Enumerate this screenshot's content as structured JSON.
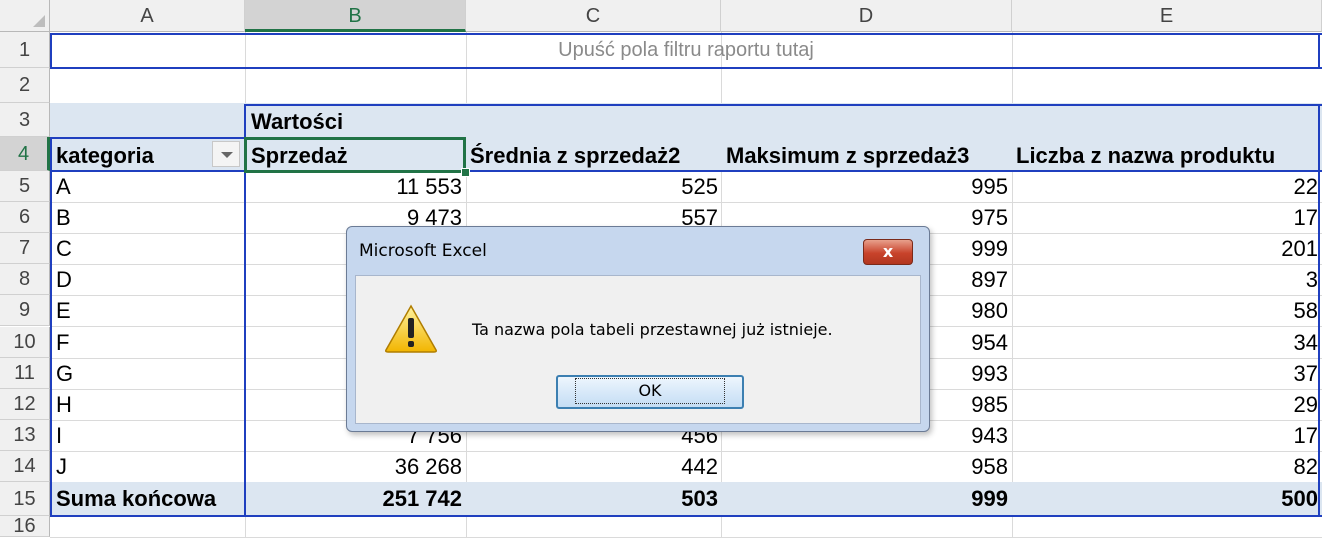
{
  "app": {
    "name": "Microsoft Excel"
  },
  "columns": [
    "A",
    "B",
    "C",
    "D",
    "E"
  ],
  "selected_column": "B",
  "rows": [
    "1",
    "2",
    "3",
    "4",
    "5",
    "6",
    "7",
    "8",
    "9",
    "10",
    "11",
    "12",
    "13",
    "14",
    "15",
    "16"
  ],
  "selected_row": "4",
  "pivot": {
    "filter_drop_label": "Upuść pola filtru raportu tutaj",
    "values_label": "Wartości",
    "row_field_header": "kategoria",
    "value_headers": [
      "Sprzedaż",
      "Średnia z sprzedaż2",
      "Maksimum z sprzedaż3",
      "Liczba z nazwa produktu"
    ],
    "data_rows": [
      {
        "cat": "A",
        "b": "11 553",
        "c": "525",
        "d": "995",
        "e": "22"
      },
      {
        "cat": "B",
        "b": "9 473",
        "c": "557",
        "d": "975",
        "e": "17"
      },
      {
        "cat": "C",
        "b": "",
        "c": "",
        "d": "999",
        "e": "201"
      },
      {
        "cat": "D",
        "b": "",
        "c": "",
        "d": "897",
        "e": "3"
      },
      {
        "cat": "E",
        "b": "",
        "c": "",
        "d": "980",
        "e": "58"
      },
      {
        "cat": "F",
        "b": "",
        "c": "",
        "d": "954",
        "e": "34"
      },
      {
        "cat": "G",
        "b": "",
        "c": "",
        "d": "993",
        "e": "37"
      },
      {
        "cat": "H",
        "b": "",
        "c": "",
        "d": "985",
        "e": "29"
      },
      {
        "cat": "I",
        "b": "7 756",
        "c": "456",
        "d": "943",
        "e": "17"
      },
      {
        "cat": "J",
        "b": "36 268",
        "c": "442",
        "d": "958",
        "e": "82"
      }
    ],
    "total_row": {
      "cat": "Suma końcowa",
      "b": "251 742",
      "c": "503",
      "d": "999",
      "e": "500"
    }
  },
  "dialog": {
    "title": "Microsoft Excel",
    "close_label": "x",
    "message": "Ta nazwa pola tabeli przestawnej już istnieje.",
    "ok_label": "OK",
    "icon": "warning-icon"
  },
  "colors": {
    "pivot_border": "#1f3fbf",
    "pivot_header_fill": "#dce6f1",
    "selection": "#217346"
  }
}
